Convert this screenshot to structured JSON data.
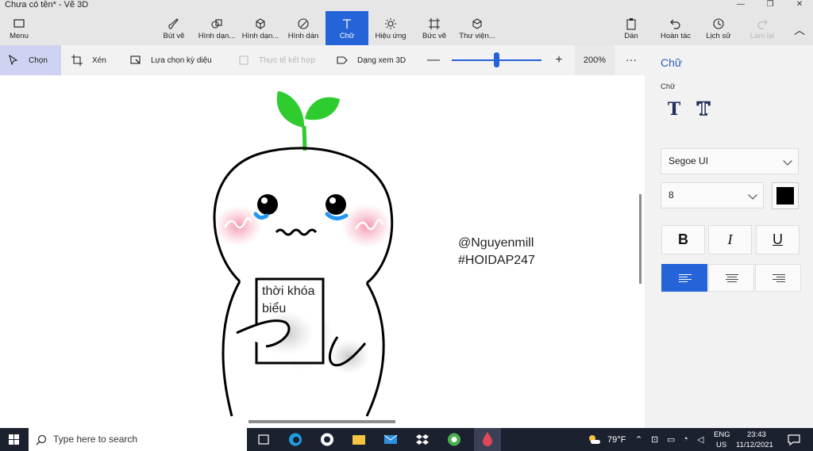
{
  "window": {
    "title": "Chưa có tên* - Vẽ 3D",
    "minimize": "—",
    "maximize": "❐",
    "close": "✕"
  },
  "ribbon": {
    "menu": "Menu",
    "tabs": [
      {
        "label": "Bút vẽ"
      },
      {
        "label": "Hình dạn..."
      },
      {
        "label": "Hình dạn..."
      },
      {
        "label": "Hình dán"
      },
      {
        "label": "Chữ"
      },
      {
        "label": "Hiệu ứng"
      },
      {
        "label": "Bức vẽ"
      },
      {
        "label": "Thư viện..."
      }
    ],
    "paste": "Dán",
    "undo": "Hoàn tác",
    "history": "Lịch sử",
    "redo": "Làm lại",
    "collapse": "︿"
  },
  "toolbar": {
    "select": "Chọn",
    "crop": "Xén",
    "magic_select": "Lựa chọn kỳ diệu",
    "mixed_reality": "Thực tế kết hợp",
    "view_3d": "Dạng xem 3D",
    "zoom_minus": "—",
    "zoom_plus": "+",
    "zoom_value": "200%",
    "zoom_fraction": 0.5,
    "more": "···"
  },
  "canvas": {
    "note_text": [
      "thời khóa",
      "biểu"
    ],
    "watermark": [
      "@Nguyenmill",
      "#HOIDAP247"
    ]
  },
  "panel": {
    "title": "Chữ",
    "section": "Chữ",
    "font": "Segoe UI",
    "size": "8",
    "text_color": "#000000",
    "bold": "B",
    "italic": "I",
    "underline": "U",
    "align_selected": "left"
  },
  "taskbar": {
    "search_placeholder": "Type here to search",
    "weather": "79°F",
    "lang_1": "ENG",
    "lang_2": "US",
    "time": "23:43",
    "date": "11/12/2021"
  },
  "colors": {
    "accent": "#2563d9",
    "leaf": "#2ecc2e",
    "blush": "#f7a8b8",
    "tear": "#2196f3"
  }
}
